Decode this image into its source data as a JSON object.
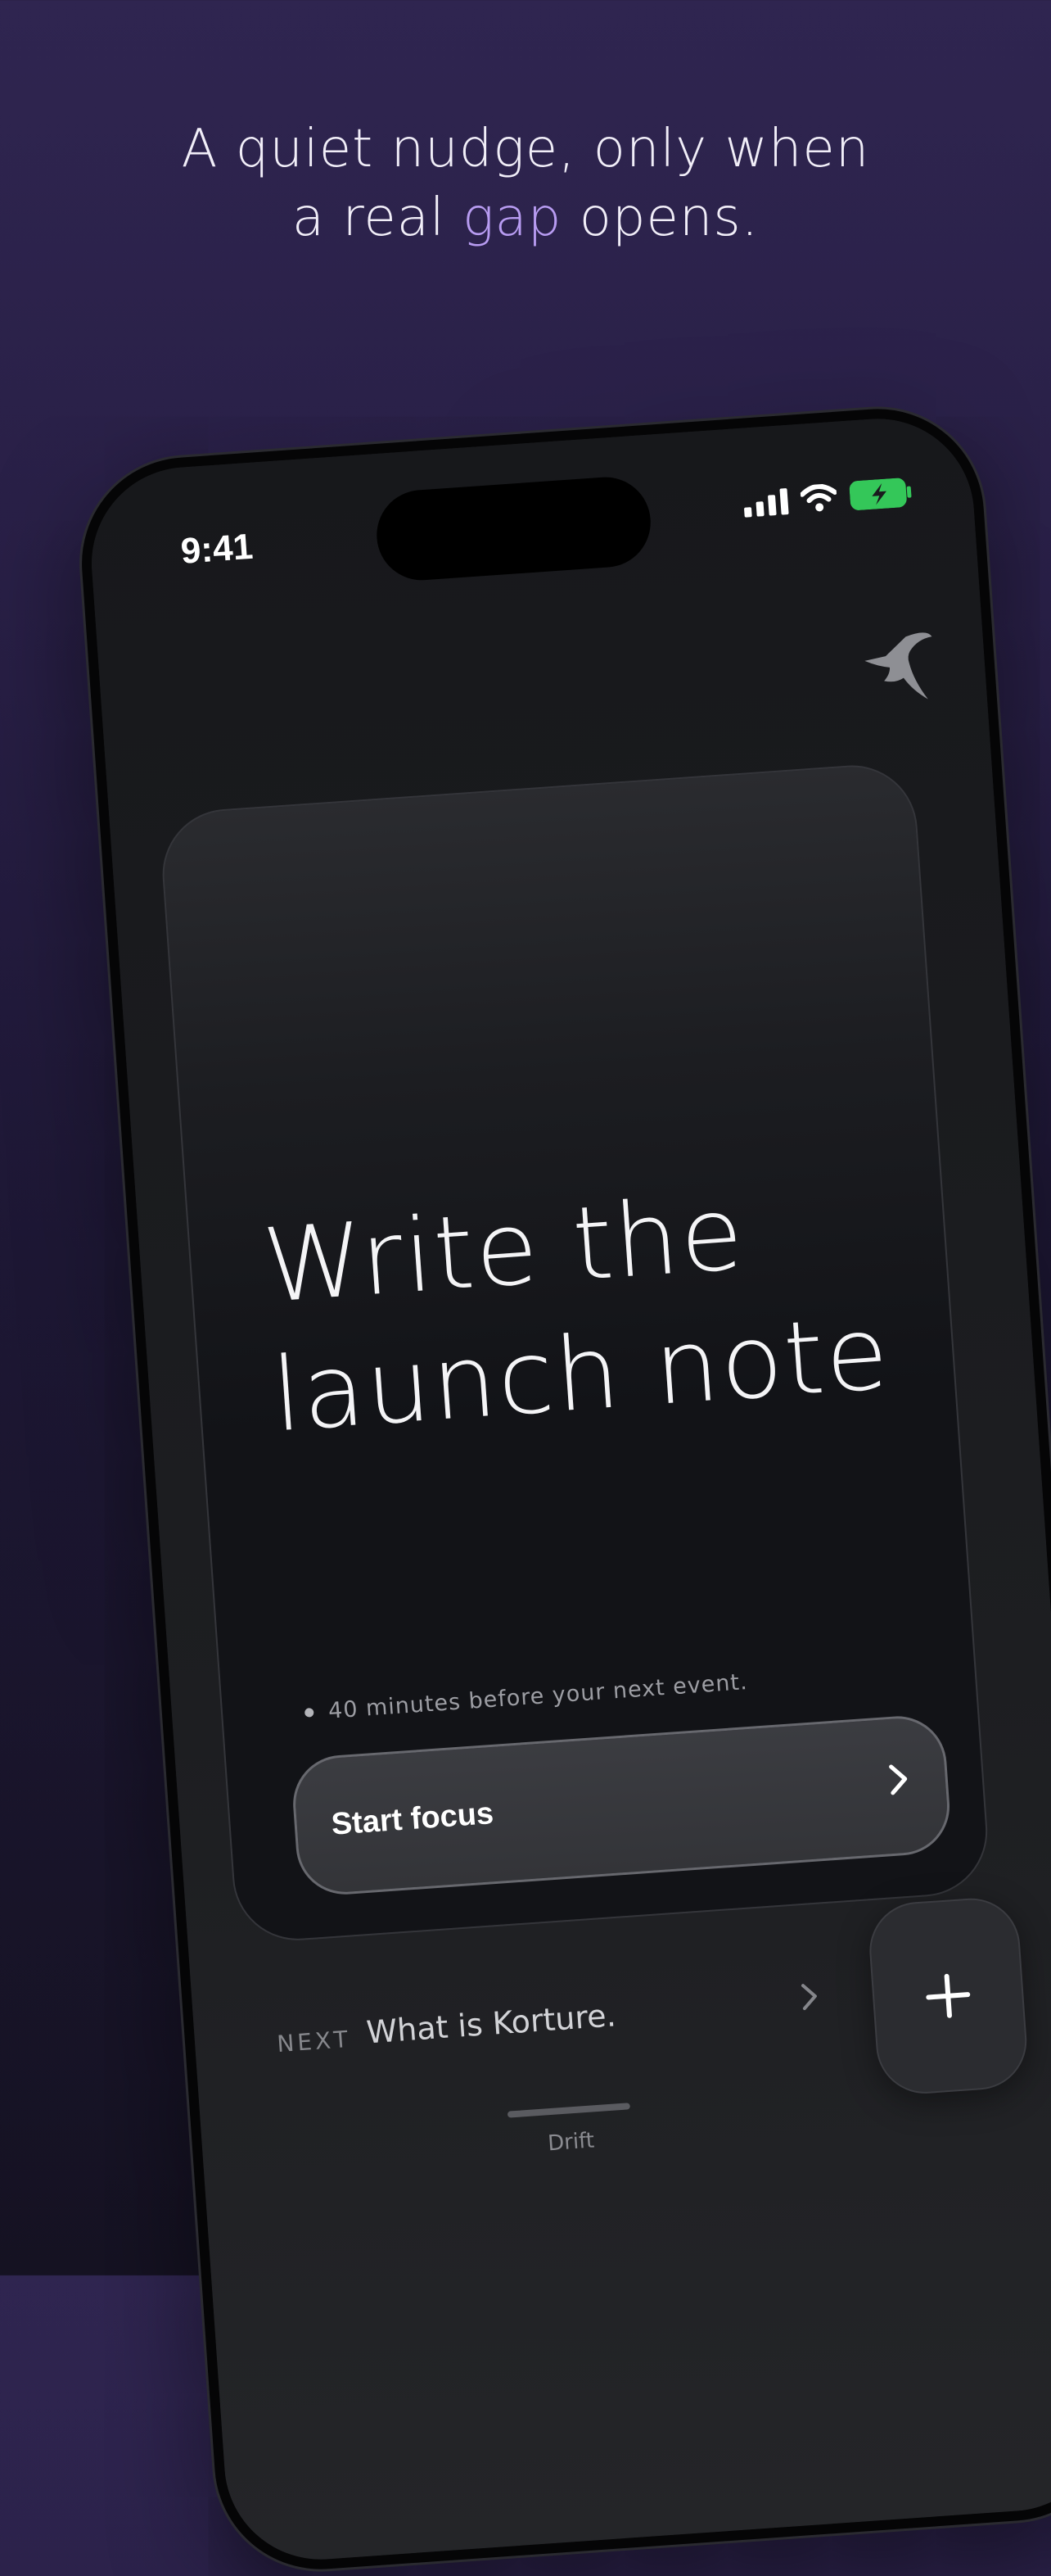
{
  "headline": {
    "line1": "A quiet nudge, only when",
    "line2_prefix": "a real ",
    "line2_accent": "gap",
    "line2_suffix": " opens."
  },
  "colors": {
    "accent": "#b89cf2",
    "background_top": "#2f2550",
    "background_bottom": "#151222",
    "battery_fill": "#34c759"
  },
  "status_bar": {
    "time": "9:41",
    "icons": [
      "cellular-signal-icon",
      "wifi-icon",
      "battery-charging-icon"
    ]
  },
  "app": {
    "logo_icon": "swift-bird-icon",
    "card": {
      "title_line1": "Write the",
      "title_line2": "launch note",
      "event_text": "40 minutes before your next event.",
      "button_label": "Start focus",
      "button_icon": "chevron-right-icon"
    },
    "next": {
      "tag": "NEXT",
      "title": "What is Korture.",
      "icon": "chevron-right-icon"
    },
    "add_button_icon": "plus-icon",
    "tab": {
      "label": "Drift"
    }
  }
}
